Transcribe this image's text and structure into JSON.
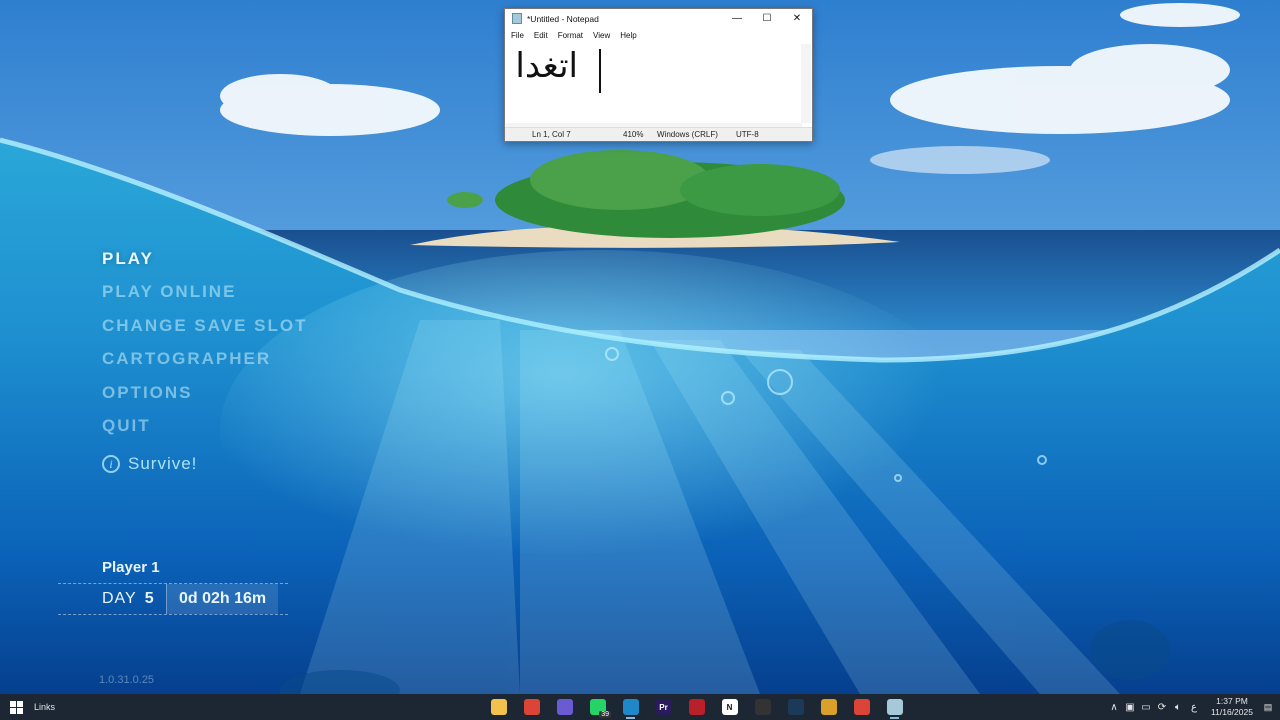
{
  "notepad": {
    "title": "*Untitled - Notepad",
    "minimize_glyph": "—",
    "maximize_glyph": "☐",
    "close_glyph": "✕",
    "menu": [
      "File",
      "Edit",
      "Format",
      "View",
      "Help"
    ],
    "content": "اتغدا",
    "status": {
      "position": "Ln 1, Col 7",
      "zoom": "410%",
      "line_ending": "Windows (CRLF)",
      "encoding": "UTF-8"
    }
  },
  "game": {
    "menu": [
      "PLAY",
      "PLAY ONLINE",
      "CHANGE SAVE SLOT",
      "CARTOGRAPHER",
      "OPTIONS",
      "QUIT"
    ],
    "active_item": "PLAY",
    "mode_label": "Survive!",
    "info_glyph": "i",
    "save": {
      "player": "Player 1",
      "day_label": "DAY",
      "day_value": "5",
      "playtime": "0d 02h 16m"
    },
    "version": "1.0.31.0.25"
  },
  "taskbar": {
    "links_label": "Links",
    "apps": [
      {
        "name": "file-explorer-icon",
        "color": "#f2c14e",
        "glyph": "",
        "running": false
      },
      {
        "name": "chrome-icon",
        "color": "#db4437",
        "glyph": "",
        "running": false
      },
      {
        "name": "chat-app-icon",
        "color": "#6b5bd2",
        "glyph": "",
        "running": false
      },
      {
        "name": "whatsapp-icon",
        "color": "#25d366",
        "glyph": "",
        "running": false,
        "badge": "39"
      },
      {
        "name": "chat-bubble-icon",
        "color": "#1e88c8",
        "glyph": "",
        "running": true
      },
      {
        "name": "premiere-icon",
        "color": "#2b1a5e",
        "glyph": "Pr",
        "running": false
      },
      {
        "name": "voicemeeter-icon",
        "color": "#b8202a",
        "glyph": "",
        "running": false
      },
      {
        "name": "notion-icon",
        "color": "#ffffff",
        "glyph": "N",
        "running": false
      },
      {
        "name": "recorder-icon",
        "color": "#333333",
        "glyph": "",
        "running": false
      },
      {
        "name": "steam-icon",
        "color": "#1b3a5a",
        "glyph": "",
        "running": false
      },
      {
        "name": "game-launcher-icon",
        "color": "#d9a12a",
        "glyph": "",
        "running": false
      },
      {
        "name": "chrome-profile-icon",
        "color": "#db4437",
        "glyph": "",
        "running": false
      },
      {
        "name": "notepad-icon",
        "color": "#a5c9d8",
        "glyph": "",
        "running": true
      }
    ],
    "tray": {
      "chevron": "∧",
      "lang": "ع",
      "time": "1:37 PM",
      "date": "11/16/2025"
    }
  }
}
